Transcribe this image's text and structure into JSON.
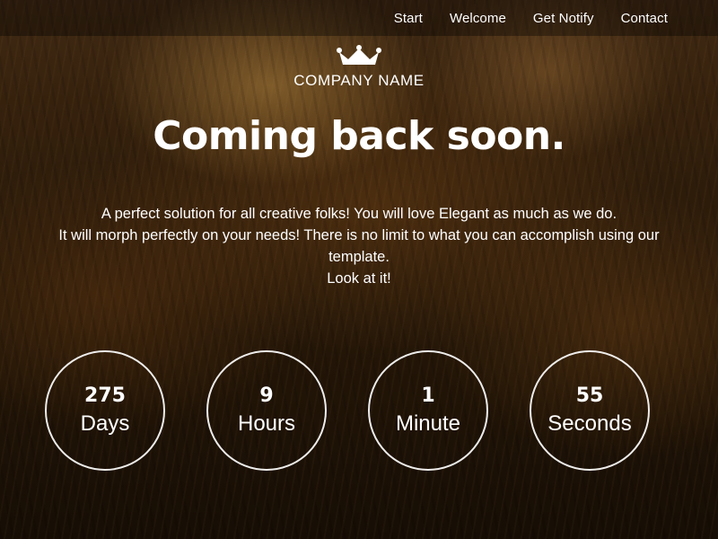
{
  "nav": {
    "items": [
      {
        "label": "Start"
      },
      {
        "label": "Welcome"
      },
      {
        "label": "Get Notify"
      },
      {
        "label": "Contact"
      }
    ]
  },
  "logo": {
    "icon": "crown-icon",
    "company_name": "COMPANY NAME"
  },
  "hero": {
    "headline": "Coming back soon.",
    "description_lines": [
      "A perfect solution for all creative folks! You will love Elegant as much as we do.",
      "It will morph perfectly on your needs! There is no limit to what you can accomplish using our template.",
      "Look at it!"
    ]
  },
  "countdown": [
    {
      "value": "275",
      "label": "Days"
    },
    {
      "value": "9",
      "label": "Hours"
    },
    {
      "value": "1",
      "label": "Minute"
    },
    {
      "value": "55",
      "label": "Seconds"
    }
  ],
  "colors": {
    "text": "#ffffff",
    "navbar_bg": "rgba(0,0,0,0.35)",
    "background_tone": "#3a240e"
  }
}
